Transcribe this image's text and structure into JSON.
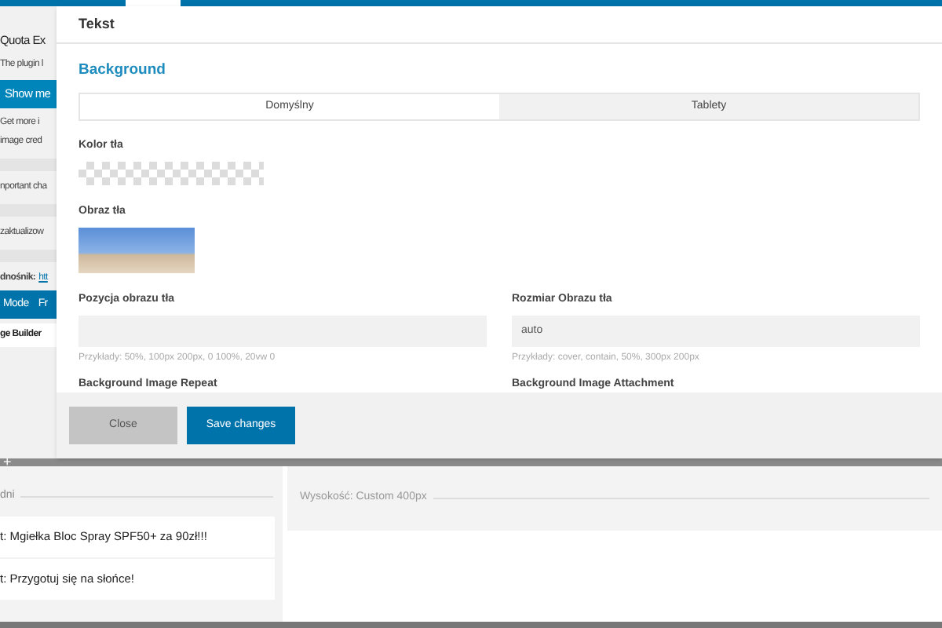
{
  "background_page": {
    "texts": [
      {
        "kind": "heading",
        "text": "Quota Ex"
      },
      {
        "kind": "text",
        "text": "The plugin l"
      },
      {
        "kind": "button",
        "text": "Show me"
      },
      {
        "kind": "text",
        "text": "Get more i"
      },
      {
        "kind": "text",
        "text": "image cred"
      },
      {
        "kind": "gap"
      },
      {
        "kind": "text",
        "text": "nportant cha"
      },
      {
        "kind": "gap"
      },
      {
        "kind": "text",
        "text": "zaktualizow"
      },
      {
        "kind": "gap"
      },
      {
        "kind": "link",
        "text": "dnośnik:",
        "link": "htt"
      },
      {
        "kind": "tabs",
        "items": [
          "Mode",
          "Fr"
        ]
      },
      {
        "kind": "tab",
        "text": "ge Builder"
      }
    ],
    "add_symbol": "+",
    "column_label": "dni",
    "list_items": [
      "t: Mgiełka Bloc Spray SPF50+ za 90zł!!!",
      "t: Przygotuj się na słońce!"
    ],
    "height_label": "Wysokość: Custom 400px"
  },
  "modal": {
    "title": "Tekst",
    "section": "Background",
    "tabs": [
      {
        "label": "Domyślny",
        "selected": true
      },
      {
        "label": "Tablety",
        "selected": false
      }
    ],
    "color_label": "Kolor tła",
    "image_label": "Obraz tła",
    "fields": [
      {
        "label": "Pozycja obrazu tła",
        "hint": "Przykłady: 50%, 100px 200px, 0 100%, 20vw 0"
      },
      {
        "label": "Rozmiar Obrazu tła",
        "value": "auto",
        "hint": "Przykłady: cover, contain, 50%, 300px 200px"
      }
    ],
    "next_labels": [
      "Background Image Repeat",
      "Background Image Attachment"
    ],
    "buttons": [
      {
        "label": "Close",
        "disabled": true
      },
      {
        "label": "Save changes",
        "disabled": false
      }
    ]
  }
}
